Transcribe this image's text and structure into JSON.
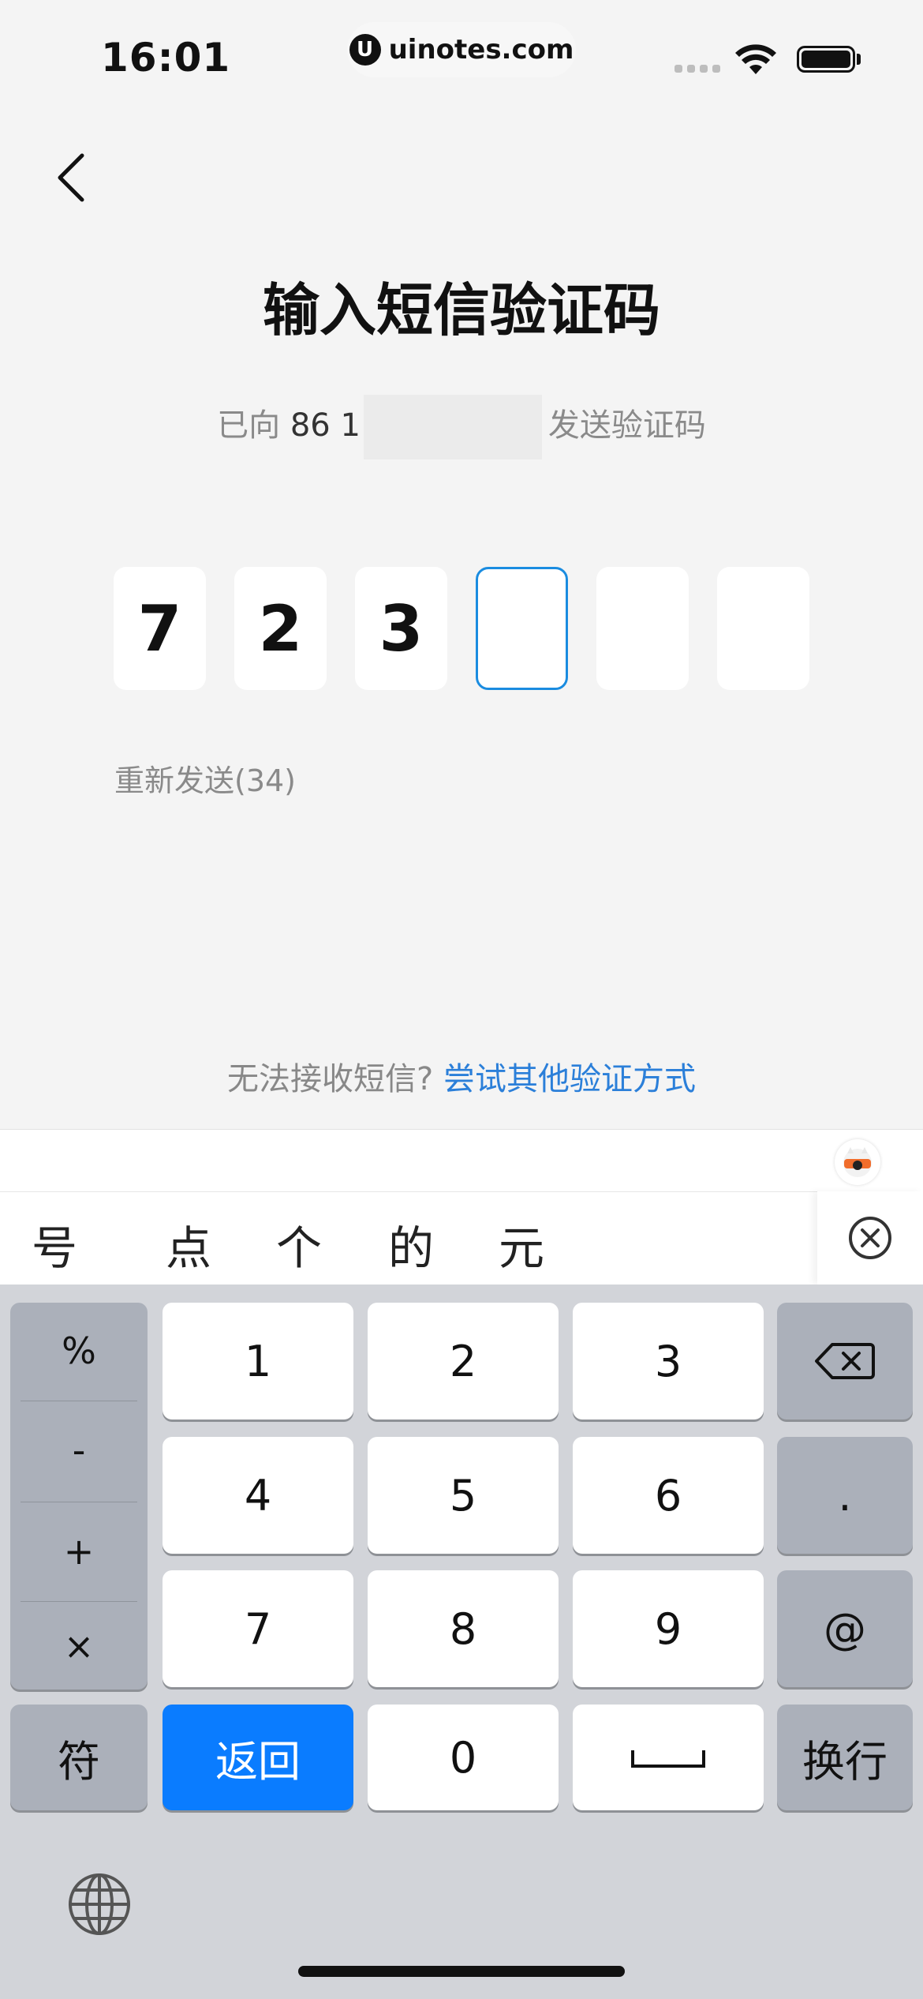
{
  "status_bar": {
    "time": "16:01",
    "url": "uinotes.com"
  },
  "header": {
    "title": "输入短信验证码"
  },
  "sent": {
    "prefix": "已向",
    "phone_visible": "86 1",
    "suffix": "发送验证码"
  },
  "code": {
    "digits": [
      "7",
      "2",
      "3",
      "",
      "",
      ""
    ],
    "active_index": 3
  },
  "resend_label": "重新发送(34)",
  "alt": {
    "question": "无法接收短信?",
    "link": "尝试其他验证方式"
  },
  "candidates": [
    "号",
    "点",
    "个",
    "的",
    "元"
  ],
  "keyboard": {
    "symbols": [
      "%",
      "-",
      "+",
      "×"
    ],
    "digits": [
      "1",
      "2",
      "3",
      "4",
      "5",
      "6",
      "7",
      "8",
      "9",
      "0"
    ],
    "dot": ".",
    "at": "@",
    "fu": "符",
    "return_label": "返回",
    "newline_label": "换行"
  },
  "colors": {
    "accent": "#1a8ce0",
    "link": "#2b7fd9",
    "return_key": "#0a7cff"
  }
}
